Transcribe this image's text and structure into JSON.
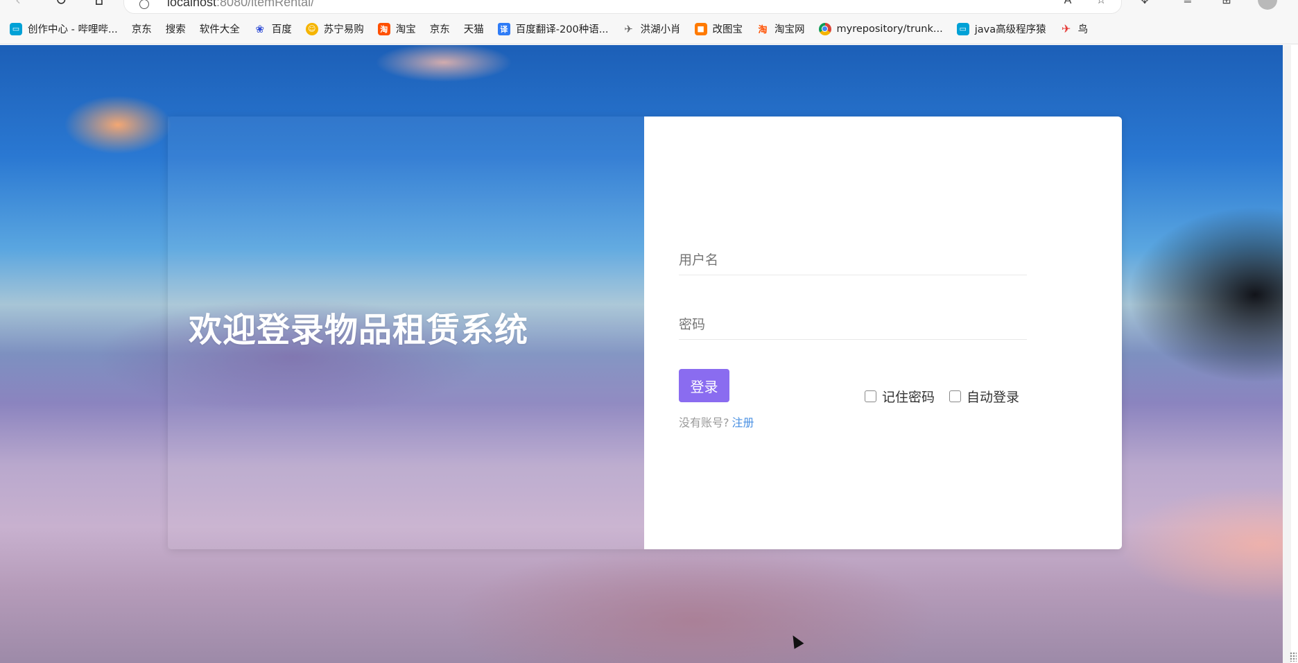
{
  "browser": {
    "url_host": "localhost",
    "url_rest": ":8080/itemRental/",
    "bookmarks": [
      {
        "label": "创作中心 - 哔哩哔...",
        "icon": "bilibili-icon"
      },
      {
        "label": "京东",
        "icon": "page-icon"
      },
      {
        "label": "搜索",
        "icon": "page-icon"
      },
      {
        "label": "软件大全",
        "icon": "page-icon"
      },
      {
        "label": "百度",
        "icon": "baidu-paw-icon"
      },
      {
        "label": "苏宁易购",
        "icon": "suning-icon"
      },
      {
        "label": "淘宝",
        "icon": "taobao-icon"
      },
      {
        "label": "京东",
        "icon": "page-icon"
      },
      {
        "label": "天猫",
        "icon": "page-icon"
      },
      {
        "label": "百度翻译-200种语...",
        "icon": "translate-icon"
      },
      {
        "label": "洪湖小肖",
        "icon": "bird-icon"
      },
      {
        "label": "改图宝",
        "icon": "gaitubao-icon"
      },
      {
        "label": "淘宝网",
        "icon": "taobao-icon"
      },
      {
        "label": "myrepository/trunk...",
        "icon": "chrome-icon"
      },
      {
        "label": "java高级程序猿",
        "icon": "bilibili-icon"
      },
      {
        "label": "鸟",
        "icon": "bird-red-icon"
      }
    ]
  },
  "welcome": {
    "title": "欢迎登录物品租赁系统"
  },
  "form": {
    "username_placeholder": "用户名",
    "password_placeholder": "密码",
    "login_label": "登录",
    "remember_label": "记住密码",
    "auto_login_label": "自动登录",
    "no_account_text": "没有账号?",
    "register_link": "注册"
  }
}
